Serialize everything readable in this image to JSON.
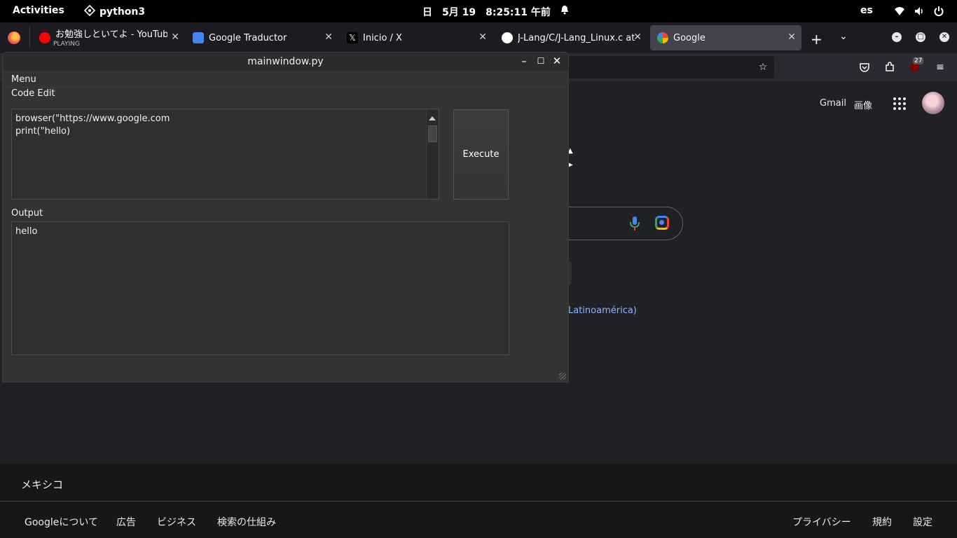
{
  "topbar": {
    "activities": "Activities",
    "app_name": "python3",
    "day": "日",
    "date": "5月 19",
    "time": "8:25:11 午前",
    "keyboard_layout": "es"
  },
  "browser": {
    "tabs": [
      {
        "label": "お勉強しといてよ - YouTube",
        "sub": "PLAYING",
        "icon": "youtube-icon",
        "color": "#ff0000"
      },
      {
        "label": "Google Traductor",
        "icon": "google-translate-icon",
        "color": "#4285f4"
      },
      {
        "label": "Inicio / X",
        "icon": "x-icon",
        "color": "#000000"
      },
      {
        "label": "J-Lang/C/J-Lang_Linux.c at",
        "icon": "github-icon",
        "color": "#ffffff"
      },
      {
        "label": "Google",
        "icon": "google-icon",
        "color": "#4285f4"
      }
    ],
    "extension_badge": "27"
  },
  "google_page": {
    "gmail": "Gmail",
    "images": "画像",
    "language_link": "Latinoamérica)",
    "country": "メキシコ",
    "footer_left": [
      "Googleについて",
      "広告",
      "ビジネス",
      "検索の仕組み"
    ],
    "footer_right": [
      "プライバシー",
      "規約",
      "設定"
    ]
  },
  "qt_window": {
    "title": "mainwindow.py",
    "menu": "Menu",
    "code_label": "Code Edit",
    "code_lines": [
      "browser(\"https://www.google.com",
      "print(\"hello)"
    ],
    "execute_label": "Execute",
    "output_label": "Output",
    "output_text": "hello"
  }
}
